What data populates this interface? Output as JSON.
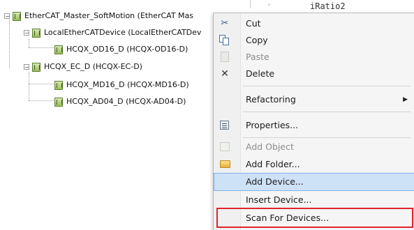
{
  "tree": {
    "items": [
      {
        "label": "EtherCAT_Master_SoftMotion (EtherCAT Mas",
        "level": 0
      },
      {
        "label": "LocalEtherCATDevice (LocalEtherCATDev",
        "level": 1
      },
      {
        "label": "HCQX_OD16_D (HCQX-OD16-D)",
        "level": 2
      },
      {
        "label": "HCQX_EC_D (HCQX-EC-D)",
        "level": 1
      },
      {
        "label": "HCQX_MD16_D (HCQX-MD16-D)",
        "level": 2
      },
      {
        "label": "HCQX_AD04_D (HCQX-AD04-D)",
        "level": 2
      }
    ],
    "expander_symbol": "−"
  },
  "background_panel": {
    "text": "iRatio2",
    "marker": "◦"
  },
  "context_menu": {
    "items": [
      {
        "label": "Cut",
        "icon": "scissors-icon",
        "enabled": true
      },
      {
        "label": "Copy",
        "icon": "copy-icon",
        "enabled": true
      },
      {
        "label": "Paste",
        "icon": "paste-icon",
        "enabled": false
      },
      {
        "label": "Delete",
        "icon": "delete-icon",
        "enabled": true
      },
      {
        "label": "Refactoring",
        "enabled": true,
        "submenu": true
      },
      {
        "label": "Properties...",
        "icon": "properties-icon",
        "enabled": true
      },
      {
        "label": "Add Object",
        "icon": "add-object-icon",
        "enabled": false
      },
      {
        "label": "Add Folder...",
        "icon": "folder-icon",
        "enabled": true
      },
      {
        "label": "Add Device...",
        "enabled": true,
        "highlighted": true
      },
      {
        "label": "Insert Device...",
        "enabled": true
      },
      {
        "label": "Scan For Devices...",
        "enabled": true,
        "outlined": true
      }
    ],
    "submenu_arrow": "▶",
    "scissors_glyph": "✂",
    "delete_glyph": "✕"
  },
  "colors": {
    "highlight_bg": "#cde1f7",
    "highlight_border": "#7eb4ea",
    "outline_red": "#e0242a",
    "disabled_text": "#8c8c8c"
  }
}
